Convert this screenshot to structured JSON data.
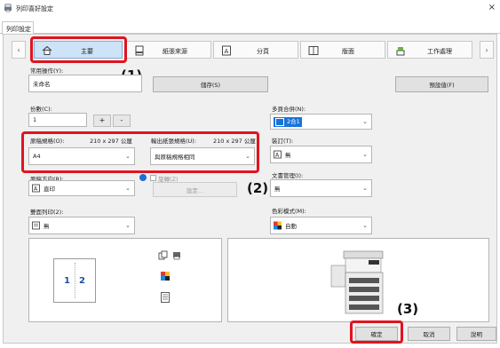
{
  "window": {
    "title": "列印喜好設定",
    "close": "×"
  },
  "outer_tab": "列印設定",
  "nav": {
    "left_arrow": "‹",
    "right_arrow": "›",
    "tabs": [
      "主要",
      "紙張來源",
      "分頁",
      "版面",
      "工作處理"
    ]
  },
  "favorites": {
    "label": "常用操作(Y):",
    "value": "未命名",
    "save": "儲存(S)",
    "defaults": "預設值(F)"
  },
  "copies": {
    "label": "份數(C):",
    "value": "1",
    "plus": "+",
    "minus": "-"
  },
  "original_size": {
    "label": "原稿規格(O):",
    "dims": "210 x 297 公厘",
    "value": "A4"
  },
  "output_size": {
    "label": "輸出紙張規格(U):",
    "dims": "210 x 297 公厘",
    "value": "與原稿規格相同"
  },
  "orientation": {
    "label": "原稿方向(R):",
    "value": "直印"
  },
  "rotate": {
    "label": "旋轉(Z)",
    "settings": "設定..."
  },
  "duplex": {
    "label": "雙面列印(2):",
    "value": "無"
  },
  "nup": {
    "label": "多頁合併(N):",
    "value": "2合1"
  },
  "staple": {
    "label": "裝訂(T):",
    "value": "無"
  },
  "filing": {
    "label": "文書管理(I):",
    "value": "無"
  },
  "color": {
    "label": "色彩模式(M):",
    "value": "自動"
  },
  "preview_pages": [
    "1",
    "2"
  ],
  "annotations": [
    "(1)",
    "(2)",
    "(3)"
  ],
  "footer": {
    "ok": "確定",
    "cancel": "取消",
    "help": "說明"
  }
}
